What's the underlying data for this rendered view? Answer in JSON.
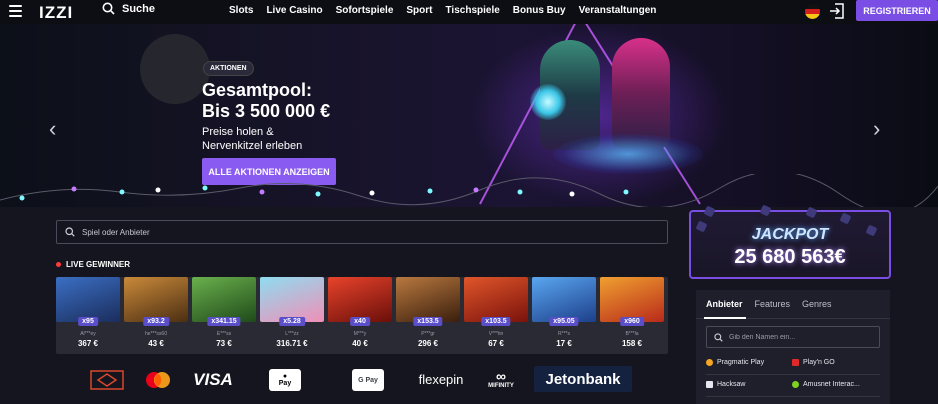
{
  "header": {
    "logo": "IZZI",
    "search_label": "Suche",
    "nav": [
      "Slots",
      "Live Casino",
      "Sofortspiele",
      "Sport",
      "Tischspiele",
      "Bonus Buy",
      "Veranstaltungen"
    ],
    "register_label": "REGISTRIEREN"
  },
  "hero": {
    "badge": "AKTIONEN",
    "title_line1": "Gesamtpool:",
    "title_line2": "Bis 3 500 000 €",
    "subtitle_line1": "Preise holen &",
    "subtitle_line2": "Nervenkitzel erleben",
    "button_label": "ALLE AKTIONEN ANZEIGEN",
    "accent": "#8a5bf0"
  },
  "game_search": {
    "placeholder": "Spiel oder Anbieter"
  },
  "live_winners": {
    "title": "LIVE GEWINNER",
    "items": [
      {
        "multiplier": "x95",
        "user": "Al***ey",
        "amount": "367 €",
        "color": "#2b4f8c"
      },
      {
        "multiplier": "x93.2",
        "user": "he***ss60",
        "amount": "43 €",
        "color": "#8c5a1e"
      },
      {
        "multiplier": "x341.15",
        "user": "E***ss",
        "amount": "73 €",
        "color": "#3f7a2a"
      },
      {
        "multiplier": "x5.28",
        "user": "L***zz",
        "amount": "316.71 €",
        "color": "#d9749a"
      },
      {
        "multiplier": "x40",
        "user": "M***y",
        "amount": "40 €",
        "color": "#b8231c"
      },
      {
        "multiplier": "x153.5",
        "user": "P***gr",
        "amount": "296 €",
        "color": "#6b3a1f"
      },
      {
        "multiplier": "x103.5",
        "user": "V***tin",
        "amount": "67 €",
        "color": "#a3201a"
      },
      {
        "multiplier": "x95.05",
        "user": "R***s",
        "amount": "17 €",
        "color": "#2f5fb3"
      },
      {
        "multiplier": "x960",
        "user": "B***la",
        "amount": "158 €",
        "color": "#c43a1e"
      }
    ]
  },
  "payments": [
    "MasterCard",
    "VISA",
    "Apple Pay",
    "Google Pay",
    "flexepin",
    "MIFINITY",
    "Jetonbank"
  ],
  "payment_texts": {
    "visa": "VISA",
    "apple_pay": "Pay",
    "google_pay": "G Pay",
    "flexepin": "flexepin",
    "mifinity": "MIFINITY",
    "jetonbank": "Jetonbank"
  },
  "jackpot": {
    "label": "JACKPOT",
    "value": "25 680 563€"
  },
  "provider_panel": {
    "tabs": [
      "Anbieter",
      "Features",
      "Genres"
    ],
    "search_placeholder": "Gib den Namen ein...",
    "providers": [
      "Pragmatic Play",
      "Play'n GO",
      "Hacksaw",
      "Amusnet Interac..."
    ]
  }
}
